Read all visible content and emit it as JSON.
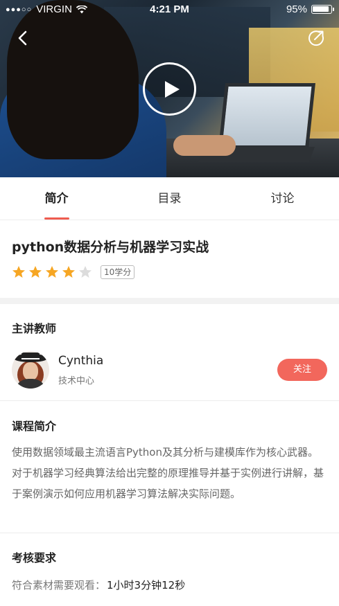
{
  "status_bar": {
    "carrier": "VIRGIN",
    "time": "4:21 PM",
    "battery": "95%"
  },
  "icons": {
    "back": "chevron-left-icon",
    "share": "share-icon",
    "play": "play-icon",
    "star": "star-icon"
  },
  "tabs": [
    {
      "label": "简介",
      "active": true
    },
    {
      "label": "目录",
      "active": false
    },
    {
      "label": "讨论",
      "active": false
    }
  ],
  "course": {
    "title": "python数据分析与机器学习实战",
    "rating": 4,
    "rating_max": 5,
    "credits": "10学分"
  },
  "teacher_section": {
    "title": "主讲教师",
    "name": "Cynthia",
    "department": "技术中心",
    "follow_label": "关注"
  },
  "intro_section": {
    "title": "课程简介",
    "text": "使用数据领域最主流语言Python及其分析与建模库作为核心武器。对于机器学习经典算法给出完整的原理推导并基于实例进行讲解，基于案例演示如何应用机器学习算法解决实际问题。"
  },
  "assessment_section": {
    "title": "考核要求",
    "label": "符合素材需要观看：",
    "value": "1小时3分钟12秒"
  },
  "colors": {
    "accent": "#ef5b4f",
    "follow_button": "#f2675c",
    "star_filled": "#f6a623",
    "star_empty": "#dcdcdc"
  }
}
